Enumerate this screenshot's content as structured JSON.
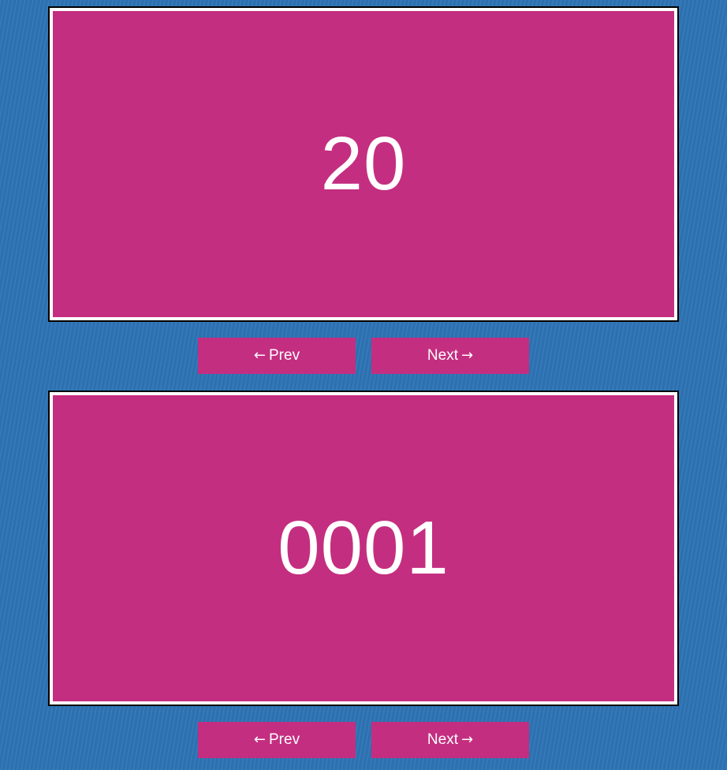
{
  "carousels": [
    {
      "slide_value": "20",
      "prev_label": "Prev",
      "next_label": "Next"
    },
    {
      "slide_value": "0001",
      "prev_label": "Prev",
      "next_label": "Next"
    }
  ],
  "icons": {
    "prev": "arrow-left-icon",
    "next": "arrow-right-icon"
  },
  "colors": {
    "background": "#2e74b5",
    "slide": "#c42e80",
    "button": "#c42e80",
    "text": "#ffffff",
    "frame": "#ffffff",
    "frame_border": "#000000"
  }
}
